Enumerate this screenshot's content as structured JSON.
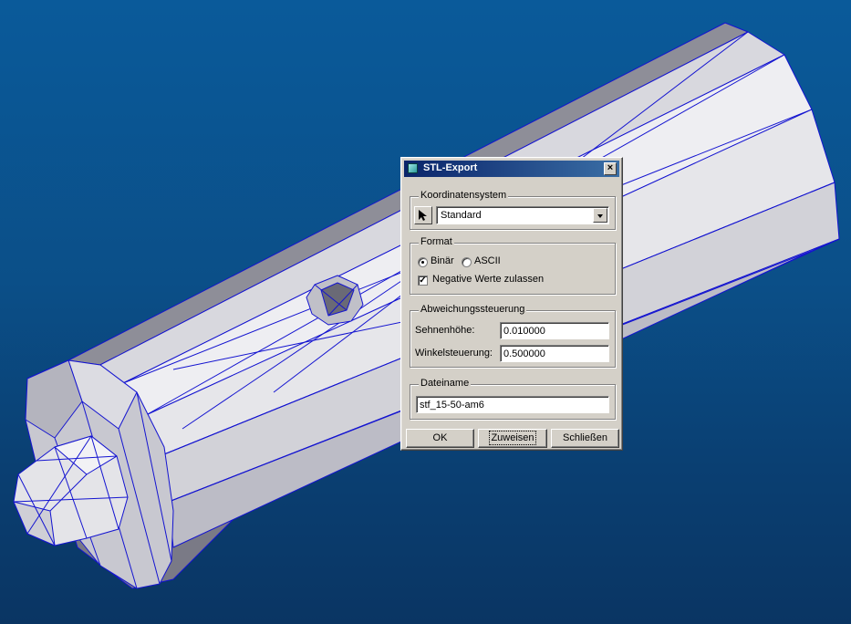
{
  "dialog": {
    "title": "STL-Export",
    "close_glyph": "×",
    "coord_group": {
      "label": "Koordinatensystem",
      "selected": "Standard",
      "picker_icon": "arrow-pointer-icon"
    },
    "format_group": {
      "label": "Format",
      "radio_binary": "Binär",
      "radio_ascii": "ASCII",
      "selected_format": "Binär",
      "negative_label": "Negative Werte zulassen",
      "negative_checked": true,
      "check_glyph": "✓"
    },
    "deviation_group": {
      "label": "Abweichungssteuerung",
      "chord_label": "Sehnenhöhe:",
      "chord_value": "0.010000",
      "angle_label": "Winkelsteuerung:",
      "angle_value": "0.500000"
    },
    "file_group": {
      "label": "Dateiname",
      "filename": "stf_15-50-am6"
    },
    "buttons": {
      "ok": "OK",
      "assign": "Zuweisen",
      "close": "Schließen"
    }
  },
  "colors": {
    "background_top": "#0a5a9a",
    "background_bottom": "#0a3563",
    "mesh_edge": "#1414d0",
    "face_light": "#e6e6ea",
    "face_mid": "#c8c8d0",
    "face_dark": "#7a7a86",
    "titlebar_start": "#0a246a",
    "titlebar_end": "#3a6ea5"
  }
}
